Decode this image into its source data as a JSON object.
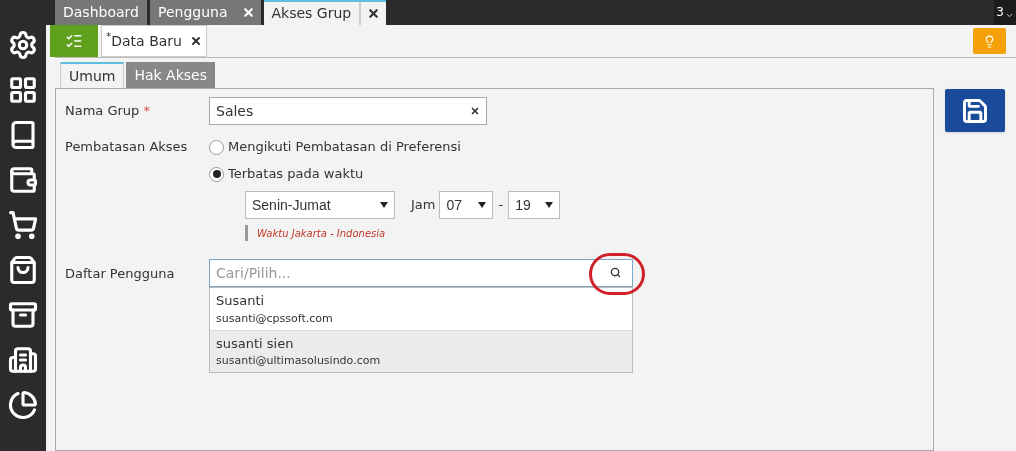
{
  "top_tabs": [
    {
      "label": "Dashboard",
      "selected": false,
      "closable": false
    },
    {
      "label": "Pengguna",
      "selected": false,
      "closable": true
    },
    {
      "label": "Akses Grup",
      "selected": true,
      "closable": true
    }
  ],
  "tab_count": "3",
  "doc_tab": {
    "modified_mark": "*",
    "label": "Data Baru"
  },
  "form_tabs": [
    {
      "label": "Umum",
      "selected": true
    },
    {
      "label": "Hak Akses",
      "selected": false
    }
  ],
  "form": {
    "group_name": {
      "label": "Nama Grup",
      "required_mark": "*",
      "value": "Sales"
    },
    "restriction": {
      "label": "Pembatasan Akses",
      "options": [
        {
          "label": "Mengikuti Pembatasan di Preferensi",
          "selected": false
        },
        {
          "label": "Terbatas pada waktu",
          "selected": true
        }
      ],
      "days": "Senin-Jumat",
      "hour_label": "Jam",
      "from": "07",
      "separator": "-",
      "to": "19",
      "timezone_note": "Waktu Jakarta - Indonesia"
    },
    "users": {
      "label": "Daftar Pengguna",
      "placeholder": "Cari/Pilih...",
      "results": [
        {
          "name": "Susanti",
          "email": "susanti@cpssoft.com",
          "selected": false
        },
        {
          "name": "susanti sien",
          "email": "susanti@ultimasolusindo.com",
          "selected": true
        }
      ]
    }
  }
}
